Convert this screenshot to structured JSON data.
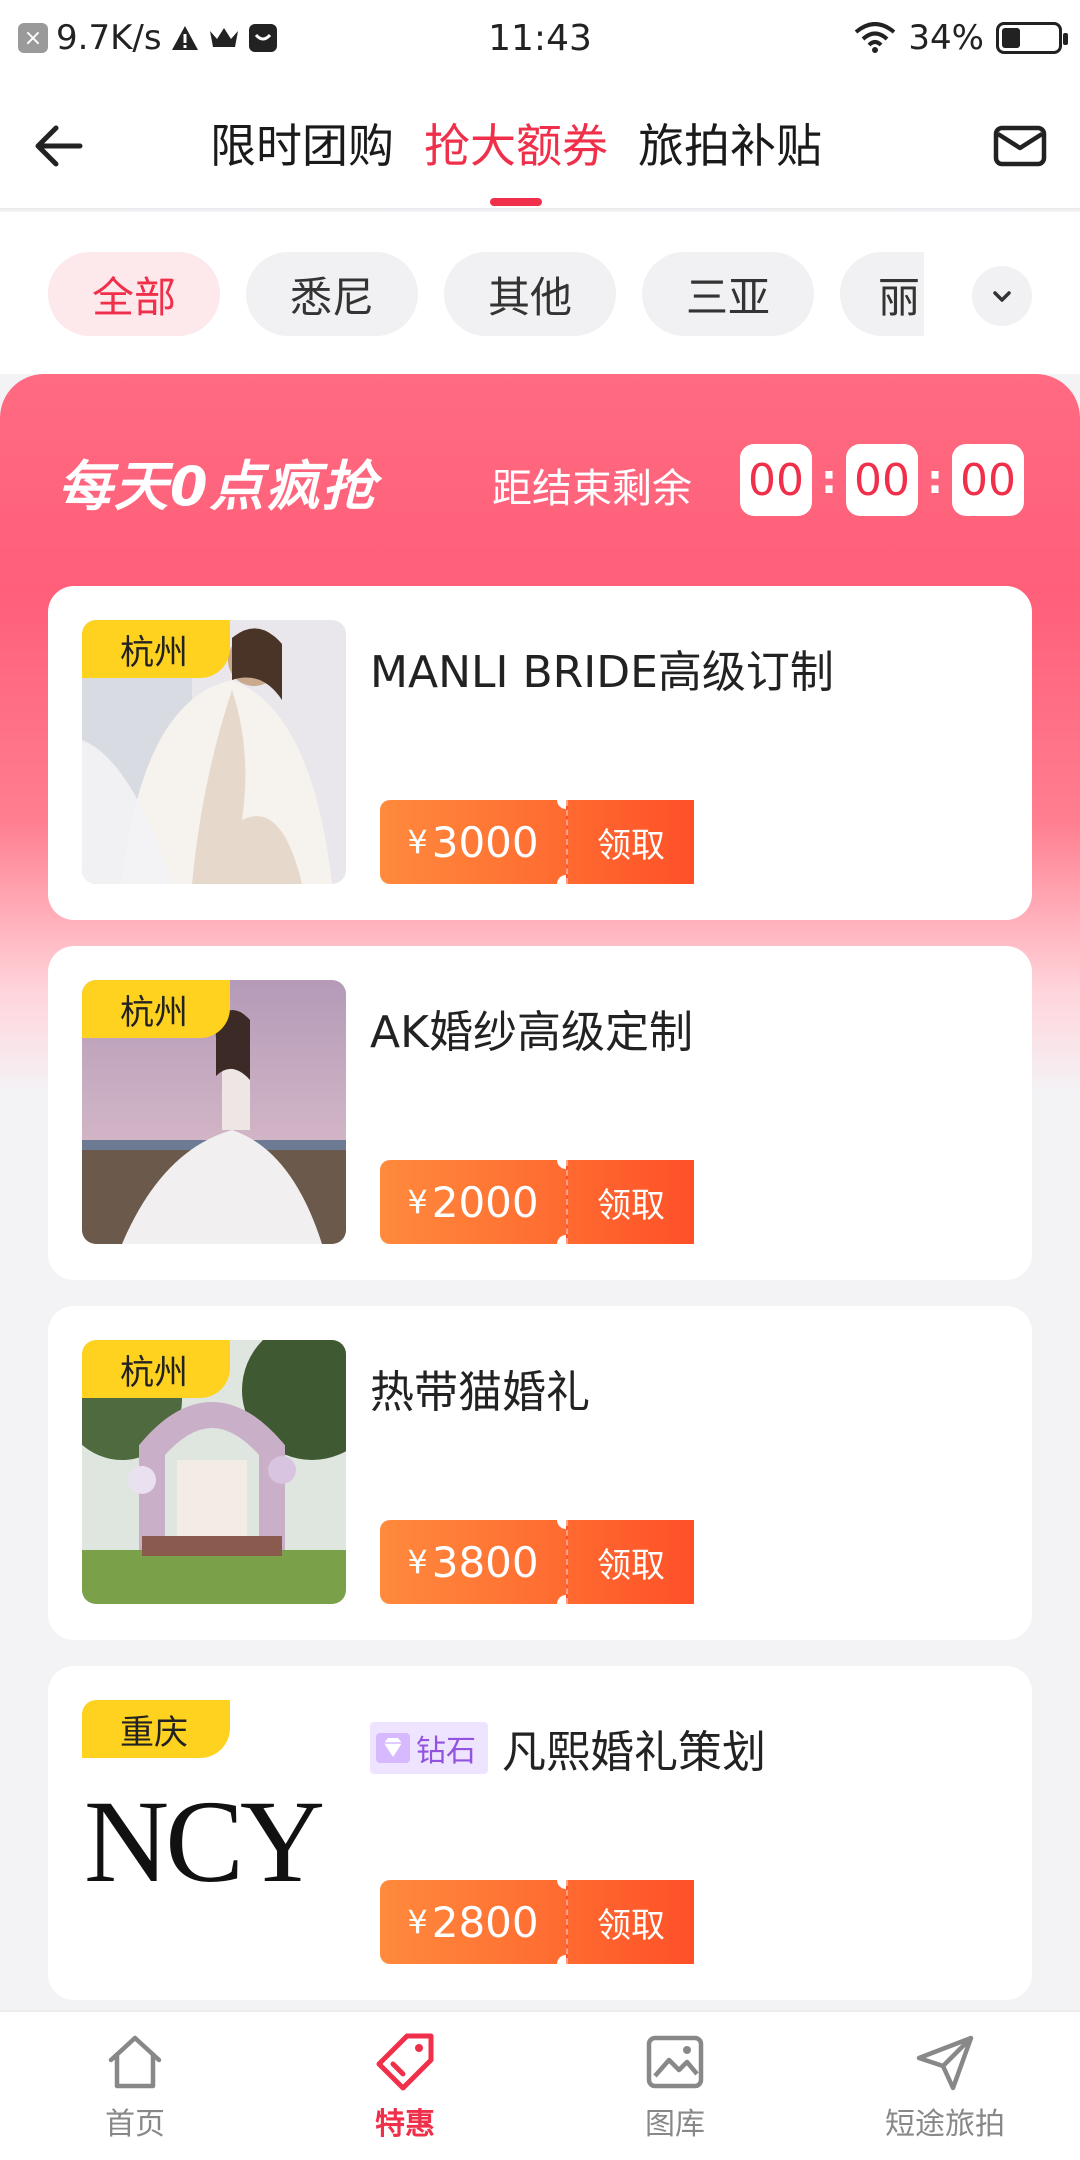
{
  "status_bar": {
    "net_speed": "9.7K/s",
    "time": "11:43",
    "battery": "34%",
    "battery_level": 0.34
  },
  "header": {
    "tabs": [
      {
        "label": "限时团购",
        "active": false
      },
      {
        "label": "抢大额券",
        "active": true
      },
      {
        "label": "旅拍补贴",
        "active": false
      }
    ]
  },
  "filters": {
    "chips": [
      "全部",
      "悉尼",
      "其他",
      "三亚",
      "丽"
    ],
    "active_index": 0
  },
  "promo": {
    "title": "每天0点疯抢",
    "countdown_label": "距结束剩余",
    "countdown": {
      "hours": "00",
      "minutes": "00",
      "seconds": "00"
    }
  },
  "coupons": [
    {
      "city": "杭州",
      "name": "MANLI BRIDE高级订制",
      "currency": "¥",
      "amount": "3000",
      "claim": "领取",
      "badge": null
    },
    {
      "city": "杭州",
      "name": "AK婚纱高级定制",
      "currency": "¥",
      "amount": "2000",
      "claim": "领取",
      "badge": null
    },
    {
      "city": "杭州",
      "name": "热带猫婚礼",
      "currency": "¥",
      "amount": "3800",
      "claim": "领取",
      "badge": null
    },
    {
      "city": "重庆",
      "name": "凡熙婚礼策划",
      "currency": "¥",
      "amount": "2800",
      "claim": "领取",
      "badge": "钻石",
      "image_text": "NCY"
    }
  ],
  "bottom_nav": [
    {
      "label": "首页",
      "icon": "home-icon",
      "active": false
    },
    {
      "label": "特惠",
      "icon": "tag-icon",
      "active": true
    },
    {
      "label": "图库",
      "icon": "gallery-icon",
      "active": false
    },
    {
      "label": "短途旅拍",
      "icon": "send-icon",
      "active": false
    }
  ],
  "colors": {
    "accent": "#f0304a",
    "city_tag": "#ffd21f",
    "coupon_start": "#ff8a3d",
    "coupon_end": "#ff5028"
  }
}
